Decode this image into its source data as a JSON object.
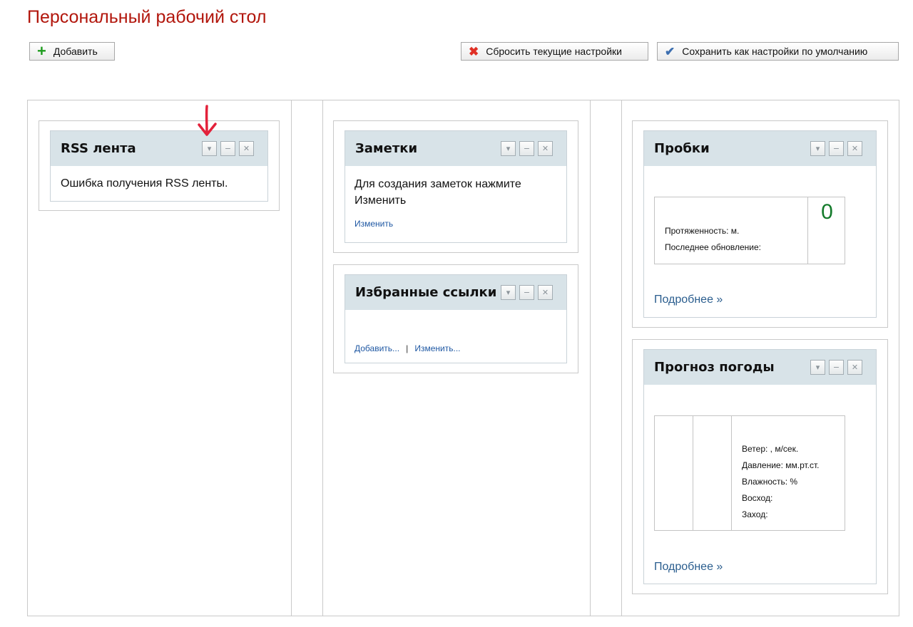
{
  "page": {
    "title": "Персональный рабочий стол"
  },
  "toolbar": {
    "add_label": "Добавить",
    "reset_label": "Сбросить текущие настройки",
    "save_default_label": "Сохранить как настройки по умолчанию"
  },
  "gadgets": {
    "rss": {
      "title": "RSS лента",
      "error_text": "Ошибка получения RSS ленты."
    },
    "notes": {
      "title": "Заметки",
      "hint_line1": "Для создания заметок нажмите",
      "hint_line2": "Изменить",
      "edit_link": "Изменить"
    },
    "favorites": {
      "title": "Избранные ссылки",
      "add_link": "Добавить...",
      "separator": "|",
      "edit_link": "Изменить..."
    },
    "traffic": {
      "title": "Пробки",
      "length_label": "Протяженность: м.",
      "updated_label": "Последнее обновление:",
      "score": "0",
      "more_link": "Подробнее »"
    },
    "weather": {
      "title": "Прогноз погоды",
      "wind_label": "Ветер: , м/сек.",
      "pressure_label": "Давление: мм.рт.ст.",
      "humidity_label": "Влажность: %",
      "sunrise_label": "Восход:",
      "sunset_label": "Заход:",
      "more_link": "Подробнее »"
    }
  },
  "tools": {
    "menu_glyph": "▾",
    "minimize_glyph": "−",
    "close_glyph": "✕"
  },
  "colors": {
    "title_red": "#b2160c",
    "header_bg": "#d8e3e8",
    "link_blue": "#1f58a3",
    "score_green": "#137a2a",
    "annotation_red": "#e3213a"
  }
}
